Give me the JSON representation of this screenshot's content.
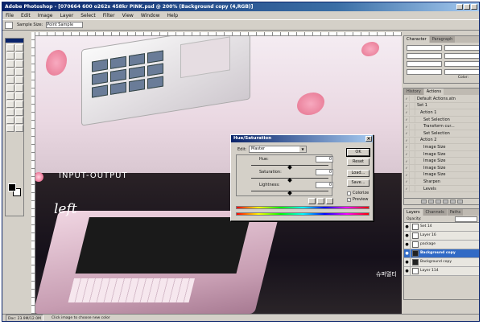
{
  "window": {
    "title": "Adobe Photoshop - [070664 600 o262x 458kr PINK.psd @ 200% (Background copy (4,RGB)]"
  },
  "menu": [
    "File",
    "Edit",
    "Image",
    "Layer",
    "Select",
    "Filter",
    "View",
    "Window",
    "Help"
  ],
  "options": {
    "label": "Sample Size:",
    "value": "Point Sample"
  },
  "canvas": {
    "brand": "INPUT-OUTPUT",
    "script": "left",
    "korean": "슈퍼멀티"
  },
  "dialog": {
    "title": "Hue/Saturation",
    "edit_label": "Edit:",
    "edit_value": "Master",
    "hue_label": "Hue:",
    "hue_value": "0",
    "saturation_label": "Saturation:",
    "saturation_value": "0",
    "lightness_label": "Lightness:",
    "lightness_value": "0",
    "buttons": [
      "OK",
      "Reset",
      "Load...",
      "Save..."
    ],
    "colorize_label": "Colorize",
    "preview_label": "Preview",
    "colorize_checked": false,
    "preview_checked": true
  },
  "character_palette": {
    "tabs": [
      "Character",
      "Paragraph"
    ],
    "fields": [
      "",
      "",
      "",
      "",
      "",
      "",
      "",
      ""
    ],
    "color_label": "Color:"
  },
  "actions_palette": {
    "tabs": [
      "History",
      "Actions"
    ],
    "items": [
      "Default Actions.atn",
      "Set 1",
      "Action 1",
      "Set Selection",
      "Transform cur...",
      "Set Selection",
      "Action 2",
      "Image Size",
      "Image Size",
      "Image Size",
      "Image Size",
      "Image Size",
      "Sharpen",
      "Levels"
    ]
  },
  "layers_palette": {
    "tabs": [
      "Layers",
      "Channels",
      "Paths"
    ],
    "opacity_label": "Opacity:",
    "layers": [
      {
        "name": "Set 14",
        "selected": false
      },
      {
        "name": "Layer 16",
        "selected": false
      },
      {
        "name": "package",
        "selected": false
      },
      {
        "name": "Background copy",
        "selected": true
      },
      {
        "name": "Background copy",
        "selected": false
      },
      {
        "name": "Layer 114",
        "selected": false
      }
    ]
  },
  "status": {
    "doc": "Doc: 23.9M/12.0M",
    "hint": "Click image to choose new color"
  }
}
